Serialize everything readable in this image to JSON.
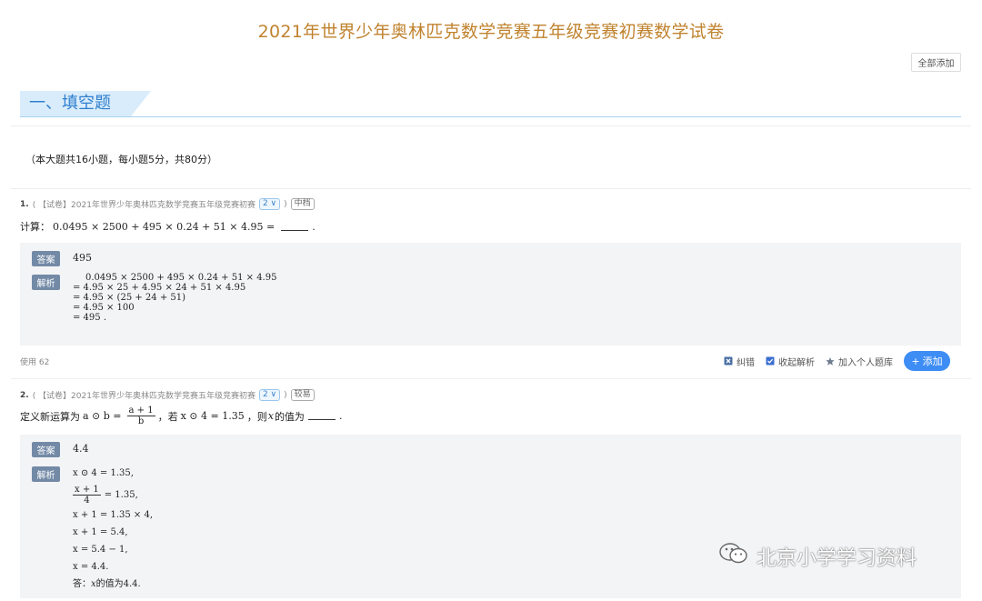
{
  "page": {
    "title": "2021年世界少年奥林匹克数学竞赛五年级竞赛初赛数学试卷",
    "add_all_label": "全部添加"
  },
  "section": {
    "title": "一、填空题",
    "info": "（本大题共16小题，每小题5分，共80分）"
  },
  "questions": [
    {
      "number": "1.",
      "source_prefix": "( 【试卷】2021年世界少年奥林匹克数学竞赛五年级竞赛初赛",
      "count_badge": "2 ∨",
      "close_paren": ")",
      "difficulty": "中档",
      "text_prefix": "计算：",
      "expression": "0.0495 × 2500 + 495 × 0.24 + 51 × 4.95 =",
      "text_suffix": ".",
      "answer_tag": "答案",
      "answer": "495",
      "explain_tag": "解析",
      "explain_lines": [
        "0.0495 × 2500 + 495 × 0.24 + 51 × 4.95",
        "= 4.95 × 25 + 4.95 × 24 + 51 × 4.95",
        "= 4.95 × (25 + 24 + 51)",
        "= 4.95 × 100",
        "= 495 ."
      ],
      "use_count": "使用 62",
      "actions": {
        "report": "纠错",
        "collapse": "收起解析",
        "add_personal": "加入个人题库",
        "add": "添加"
      }
    },
    {
      "number": "2.",
      "source_prefix": "( 【试卷】2021年世界少年奥林匹克数学竞赛五年级竞赛初赛",
      "count_badge": "2 ∨",
      "close_paren": ")",
      "difficulty": "较易",
      "text_prefix": "定义新运算为",
      "def_left": "a ⊙ b =",
      "frac_num": "a + 1",
      "frac_den": "b",
      "text_mid": "，若",
      "condition": "x ⊙ 4 = 1.35",
      "text_mid2": "，则",
      "var": "x",
      "text_suffix1": "的值为",
      "text_suffix2": ".",
      "answer_tag": "答案",
      "answer": "4.4",
      "explain_tag": "解析",
      "explain_line1": "x ⊙ 4 = 1.35,",
      "explain_frac_num": "x + 1",
      "explain_frac_den": "4",
      "explain_line2_rest": "= 1.35,",
      "explain_lines_rest": [
        "x + 1 = 1.35 × 4,",
        "x + 1 = 5.4,",
        "x = 5.4 − 1,",
        "x = 4.4."
      ],
      "final_prefix": "答：",
      "final_var": "x",
      "final_suffix": "的值为4.4."
    }
  ],
  "watermark": "北京小学学习资料",
  "colors": {
    "title": "#c0832f",
    "section_text": "#2f7fcf",
    "section_bg": "#d9ecfb",
    "tag_bg": "#738aa6",
    "add_button": "#3d8df5"
  }
}
